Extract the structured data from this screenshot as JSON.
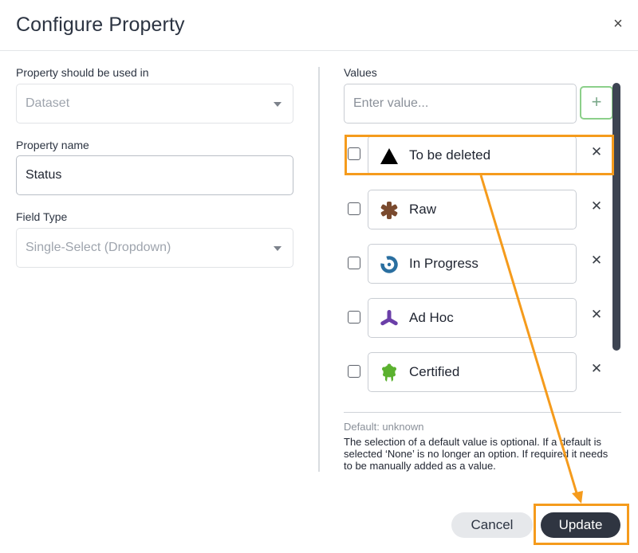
{
  "dialog": {
    "title": "Configure Property",
    "close_glyph": "×"
  },
  "left": {
    "used_in_label": "Property should be used in",
    "used_in_value": "Dataset",
    "name_label": "Property name",
    "name_value": "Status",
    "field_type_label": "Field Type",
    "field_type_value": "Single-Select (Dropdown)"
  },
  "right": {
    "values_label": "Values",
    "value_input_placeholder": "Enter value...",
    "add_glyph": "+",
    "remove_glyph": "✕",
    "items": [
      {
        "label": "To be deleted",
        "icon": "triangle-icon",
        "color": "#000000"
      },
      {
        "label": "Raw",
        "icon": "asterisk-icon",
        "color": "#7a4a2e"
      },
      {
        "label": "In Progress",
        "icon": "progress-ring-icon",
        "color": "#2a6fa0"
      },
      {
        "label": "Ad Hoc",
        "icon": "tripod-icon",
        "color": "#6b3fa8"
      },
      {
        "label": "Certified",
        "icon": "badge-icon",
        "color": "#5bb12f"
      }
    ],
    "default_text": "Default: unknown",
    "help_text": "The selection of a default value is optional. If a default is selected ‘None’ is no longer an option. If required it needs to be manually added as a value."
  },
  "footer": {
    "cancel_label": "Cancel",
    "update_label": "Update"
  },
  "annotation": {
    "highlight_color": "#f59b1c"
  }
}
